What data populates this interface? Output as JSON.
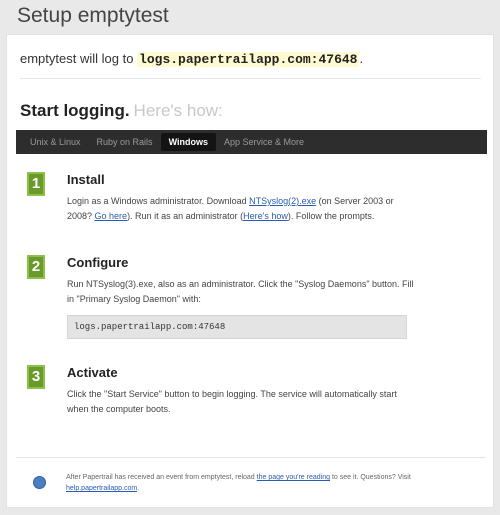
{
  "page": {
    "title": "Setup emptytest"
  },
  "log_line": {
    "prefix": "emptytest will log to ",
    "host": "logs.papertrailapp.com:47648",
    "suffix": "."
  },
  "start": {
    "heading": "Start logging.",
    "subheading": "Here's how:"
  },
  "tabs": [
    {
      "label": "Unix & Linux",
      "active": false
    },
    {
      "label": "Ruby on Rails",
      "active": false
    },
    {
      "label": "Windows",
      "active": true
    },
    {
      "label": "App Service & More",
      "active": false
    }
  ],
  "steps": {
    "install": {
      "number": "1",
      "title": "Install",
      "t1": "Login as a Windows administrator. Download ",
      "link1": "NTSyslog(2).exe",
      "t2": " (on Server 2003 or 2008? ",
      "link2": "Go here",
      "t3": "). Run it as an administrator (",
      "link3": "Here's how",
      "t4": "). Follow the prompts."
    },
    "configure": {
      "number": "2",
      "title": "Configure",
      "text": "Run NTSyslog(3).exe, also as an administrator. Click the \"Syslog Daemons\" button. Fill in \"Primary Syslog Daemon\" with:",
      "code": "logs.papertrailapp.com:47648"
    },
    "activate": {
      "number": "3",
      "title": "Activate",
      "text": "Click the \"Start Service\" button to begin logging. The service will automatically start when the computer boots."
    }
  },
  "footer": {
    "t1": "After Papertrail has received an event from emptytest, reload ",
    "link1": "the page you're reading",
    "t2": " to see it. Questions? Visit ",
    "link2": "help.papertrailapp.com",
    "t3": "."
  },
  "colors": {
    "accent_green": "#6a9a2a",
    "link_blue": "#2a5db0",
    "tabbar_bg": "#2d2d2d"
  }
}
